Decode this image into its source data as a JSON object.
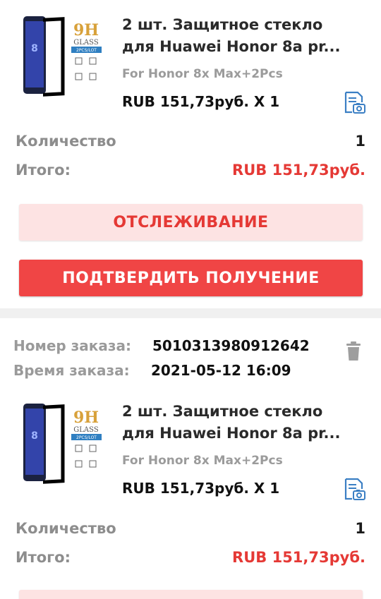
{
  "order1": {
    "product": {
      "thumb_text": "9H",
      "thumb_sub": "GLASS",
      "thumb_badge": "2PCS/LOT",
      "title_line1": "2 шт. Защитное стекло",
      "title_line2": "для Huawei Honor 8a pr...",
      "variant": "For Honor 8x Max+2Pcs",
      "price": "RUB 151,73руб. X 1",
      "snapshot_icon": "snapshot-icon"
    },
    "quantity_label": "Количество",
    "quantity_value": "1",
    "total_label": "Итого:",
    "total_value": "RUB 151,73руб.",
    "track_button": "ОТСЛЕЖИВАНИЕ",
    "confirm_button": "ПОДТВЕРДИТЬ ПОЛУЧЕНИЕ"
  },
  "order2": {
    "order_number_label": "Номер заказа:",
    "order_number": "5010313980912642",
    "order_time_label": "Время заказа:",
    "order_time": "2021-05-12 16:09",
    "delete_icon": "trash-icon",
    "product": {
      "thumb_text": "9H",
      "thumb_sub": "GLASS",
      "thumb_badge": "2PCS/LOT",
      "title_line1": "2 шт. Защитное стекло",
      "title_line2": "для Huawei Honor 8a pr...",
      "variant": "For Honor 8x Max+2Pcs",
      "price": "RUB 151,73руб. X 1",
      "snapshot_icon": "snapshot-icon"
    },
    "quantity_label": "Количество",
    "quantity_value": "1",
    "total_label": "Итого:",
    "total_value": "RUB 151,73руб."
  },
  "colors": {
    "accent": "#e53935",
    "confirm_bg": "#f04545",
    "track_bg": "#fde3e3",
    "snapshot_icon": "#3b7fc4"
  }
}
